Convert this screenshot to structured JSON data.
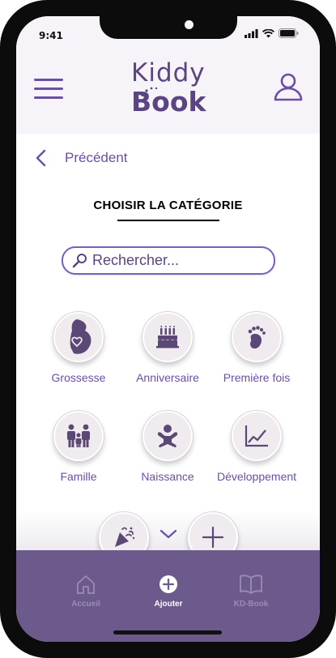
{
  "status": {
    "time": "9:41"
  },
  "app": {
    "logo_top": "Kiddy",
    "logo_bottom": "Book",
    "brand_color": "#6b4ea8"
  },
  "nav": {
    "back_label": "Précédent"
  },
  "page": {
    "title": "CHOISIR LA CATÉGORIE"
  },
  "search": {
    "placeholder": "Rechercher..."
  },
  "categories": [
    {
      "label": "Grossesse",
      "icon": "pregnancy-icon"
    },
    {
      "label": "Anniversaire",
      "icon": "birthday-cake-icon"
    },
    {
      "label": "Première fois",
      "icon": "footprint-icon"
    },
    {
      "label": "Famille",
      "icon": "family-icon"
    },
    {
      "label": "Naissance",
      "icon": "baby-icon"
    },
    {
      "label": "Développement",
      "icon": "chart-icon"
    }
  ],
  "tabs": [
    {
      "label": "Accueil",
      "icon": "home-icon",
      "active": false
    },
    {
      "label": "Ajouter",
      "icon": "plus-circle-icon",
      "active": true
    },
    {
      "label": "KD-Book",
      "icon": "book-icon",
      "active": false
    }
  ],
  "colors": {
    "tabbar": "#6c5a8c",
    "header": "#f7f4f9",
    "accent": "#6b4ea8"
  }
}
